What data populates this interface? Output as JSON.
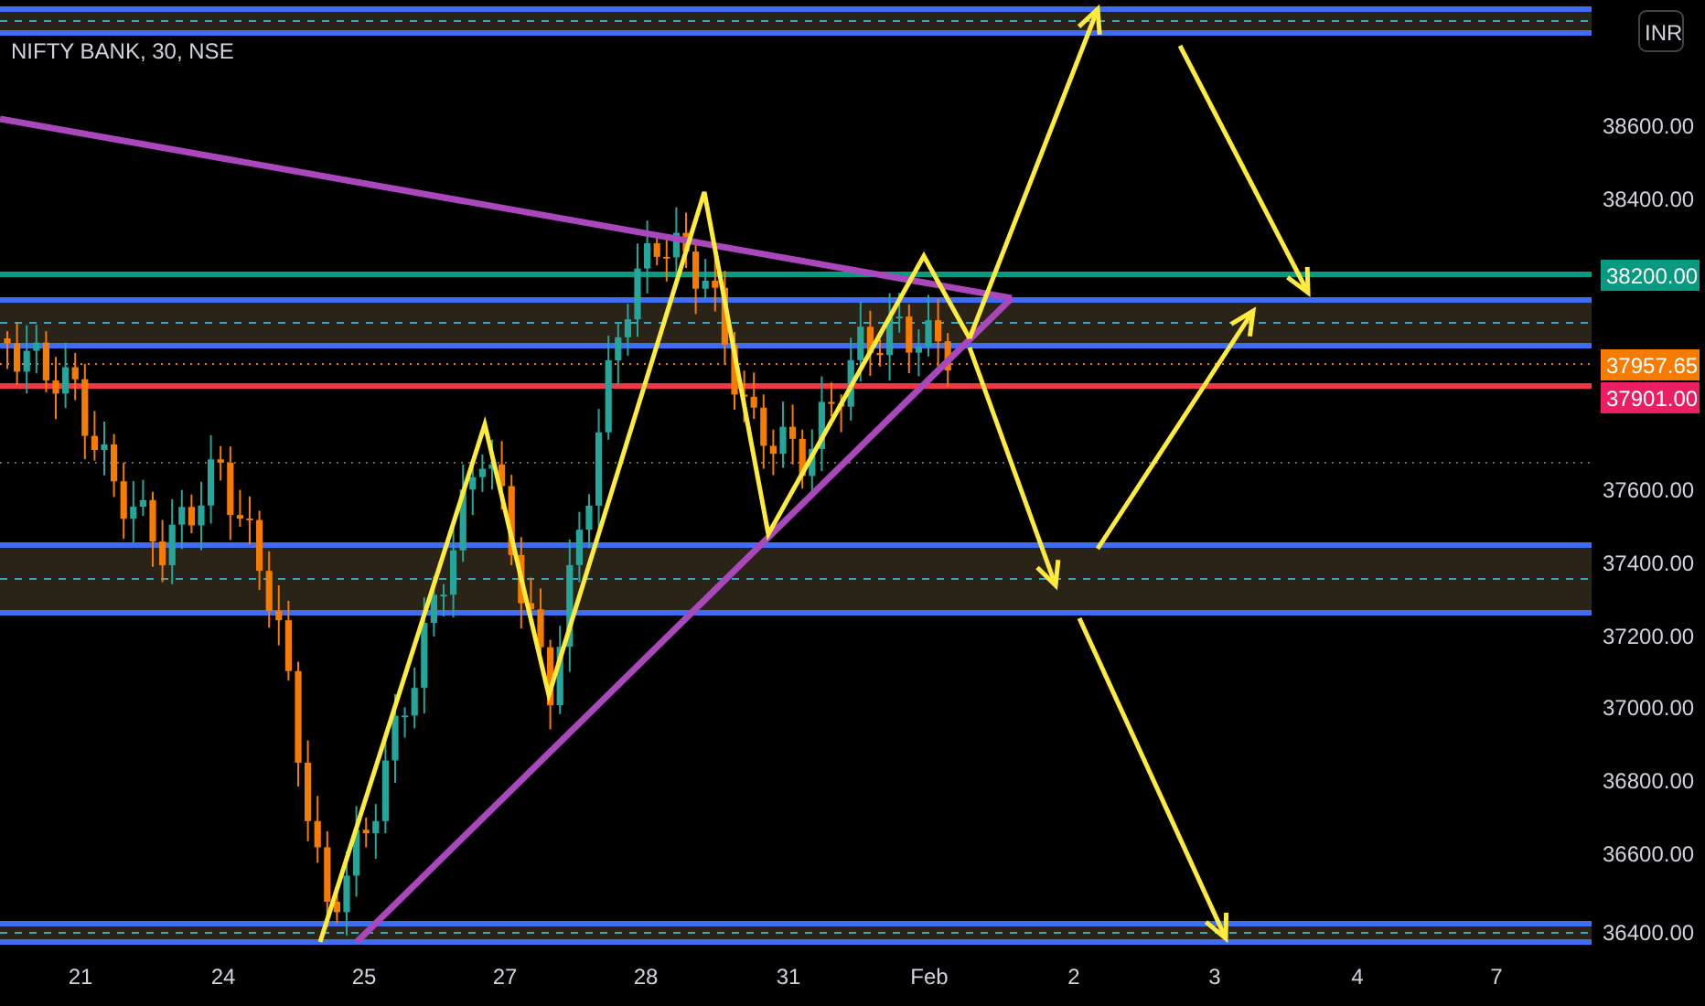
{
  "chart": {
    "title": "NIFTY BANK, 30, NSE",
    "currency": "INR",
    "price_axis": [
      "38600.00",
      "38400.00",
      "37600.00",
      "37400.00",
      "37200.00",
      "37000.00",
      "36800.00",
      "36600.00",
      "36400.00"
    ],
    "price_tags": [
      {
        "text": "38200.00",
        "color": "#089981"
      },
      {
        "text": "37957.65",
        "color": "#f57c00"
      },
      {
        "text": "37901.00",
        "color": "#e91e63"
      }
    ],
    "time_axis": [
      "21",
      "24",
      "25",
      "27",
      "28",
      "31",
      "Feb",
      "2",
      "3",
      "4",
      "7"
    ]
  }
}
